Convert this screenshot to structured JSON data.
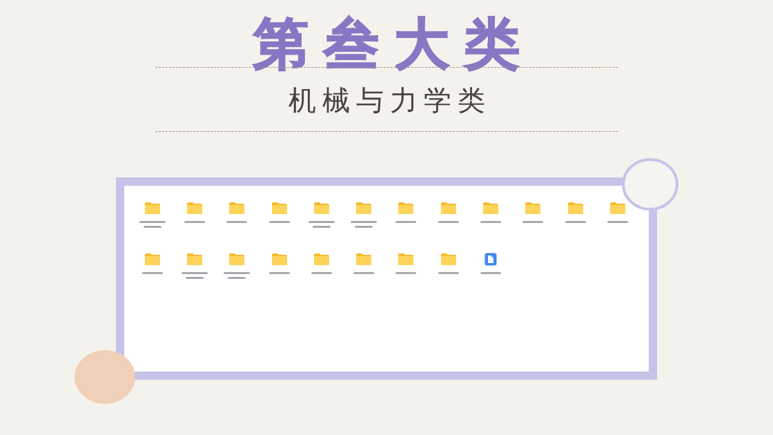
{
  "title": "第叁大类",
  "subtitle": "机械与力学类",
  "files": [
    {
      "kind": "folder",
      "caption_wrapped": true
    },
    {
      "kind": "folder",
      "caption_wrapped": false
    },
    {
      "kind": "folder",
      "caption_wrapped": false
    },
    {
      "kind": "folder",
      "caption_wrapped": false
    },
    {
      "kind": "folder",
      "caption_wrapped": true
    },
    {
      "kind": "folder",
      "caption_wrapped": true
    },
    {
      "kind": "folder",
      "caption_wrapped": false
    },
    {
      "kind": "folder",
      "caption_wrapped": false
    },
    {
      "kind": "folder",
      "caption_wrapped": false
    },
    {
      "kind": "folder",
      "caption_wrapped": false
    },
    {
      "kind": "folder",
      "caption_wrapped": false
    },
    {
      "kind": "folder",
      "caption_wrapped": false
    },
    {
      "kind": "folder",
      "caption_wrapped": false
    },
    {
      "kind": "folder",
      "caption_wrapped": true
    },
    {
      "kind": "folder",
      "caption_wrapped": true
    },
    {
      "kind": "folder",
      "caption_wrapped": false
    },
    {
      "kind": "folder",
      "caption_wrapped": false
    },
    {
      "kind": "folder",
      "caption_wrapped": false
    },
    {
      "kind": "folder",
      "caption_wrapped": false
    },
    {
      "kind": "folder",
      "caption_wrapped": false
    },
    {
      "kind": "document",
      "caption_wrapped": false
    }
  ]
}
